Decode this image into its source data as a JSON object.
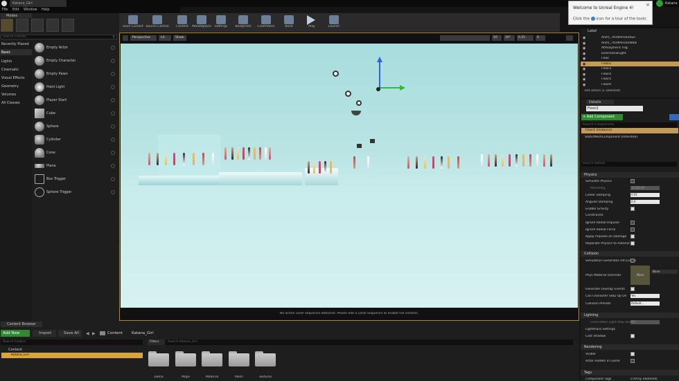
{
  "window": {
    "tab_title": "Katana_Girl",
    "user": "Katana"
  },
  "menu": [
    "File",
    "Edit",
    "Window",
    "Help"
  ],
  "modes": {
    "title": "Modes",
    "search_placeholder": "Search Classes",
    "categories": [
      "Recently Placed",
      "Basic",
      "Lights",
      "Cinematic",
      "Visual Effects",
      "Geometry",
      "Volumes",
      "All Classes"
    ],
    "items": [
      "Empty Actor",
      "Empty Character",
      "Empty Pawn",
      "Point Light",
      "Player Start",
      "Cube",
      "Sphere",
      "Cylinder",
      "Cone",
      "Plane",
      "Box Trigger",
      "Sphere Trigger"
    ]
  },
  "toolbar": [
    "Save Current",
    "Source Control",
    "Content",
    "Marketplace",
    "Settings",
    "Blueprints",
    "Cinematics",
    "Build",
    "Play",
    "Launch"
  ],
  "viewport": {
    "perspective": "Perspective",
    "lit": "Lit",
    "show": "Show",
    "snap_values": [
      "10",
      "10°",
      "0.25",
      "4"
    ],
    "status": "No active Level Sequence detected. Please edit a Level Sequence to enable full controls."
  },
  "toast": {
    "title": "Welcome to Unreal Engine 4!",
    "body_pre": "Click the",
    "body_post": "icon for a tour of the tools."
  },
  "outliner": {
    "column": "Label",
    "rows": [
      "Anim_ThirdPersonRun",
      "Anim_ThirdPersonWalk",
      "Atmospheric Fog",
      "DirectionalLight",
      "Floor",
      "Floor2",
      "Floor3",
      "Floor4",
      "Floor5",
      "Floor6"
    ],
    "selected": "Floor2",
    "count": "144 actors (1 selected)"
  },
  "details": {
    "tab": "Details",
    "name": "Floor2",
    "add_component": "+ Add Component",
    "search_components": "Search Components",
    "instance": "Floor2 (Instance)",
    "component": "StaticMeshComponent (Inherited)",
    "search_details": "Search Details",
    "physics": {
      "header": "Physics",
      "simulate": "Simulate Physics",
      "mass_label": "MassInKg",
      "mass_value": "31500.00",
      "linear_damping": "Linear Damping",
      "linear_value": "0.01",
      "angular_damping": "Angular Damping",
      "angular_value": "0.0",
      "enable_gravity": "Enable Gravity",
      "constraints": "Constraints",
      "ignore_radial_impulse": "Ignore Radial Impulse",
      "ignore_radial_force": "Ignore Radial Force",
      "apply_impulse": "Apply Impulse on Damage",
      "replicate": "Replicate Physics to Autonomo"
    },
    "collision": {
      "header": "Collision",
      "hit_events": "Simulation Generates Hit Events",
      "phys_material": "Phys Material Override",
      "none": "None",
      "thumb_none": "None",
      "overlap": "Generate Overlap Events",
      "step_up": "Can Character Step Up On",
      "step_up_value": "Yes",
      "presets": "Collision Presets",
      "presets_value": "Default..."
    },
    "lighting": {
      "header": "Lighting",
      "override_res": "Overridden Light Map Res",
      "override_value": "64",
      "lightmass": "Lightmass Settings",
      "cast_shadow": "Cast Shadow"
    },
    "rendering": {
      "header": "Rendering",
      "visible": "Visible",
      "hidden_game": "Actor Hidden In Game"
    },
    "tags": {
      "header": "Tags",
      "component_tags": "Component Tags",
      "component_tags_value": "0 Array elements"
    }
  },
  "content_browser": {
    "tab": "Content Browser",
    "add_new": "Add New",
    "import": "Import",
    "save_all": "Save All",
    "path": [
      "Content",
      "Katana_Girl"
    ],
    "search_folders": "Search Folders",
    "tree": [
      "Content",
      "Katana_Girl"
    ],
    "filters": "Filters",
    "search_placeholder": "Search Katana_Girl",
    "folders": [
      "Demo",
      "Maps",
      "Material",
      "Mesh",
      "Textures"
    ]
  }
}
